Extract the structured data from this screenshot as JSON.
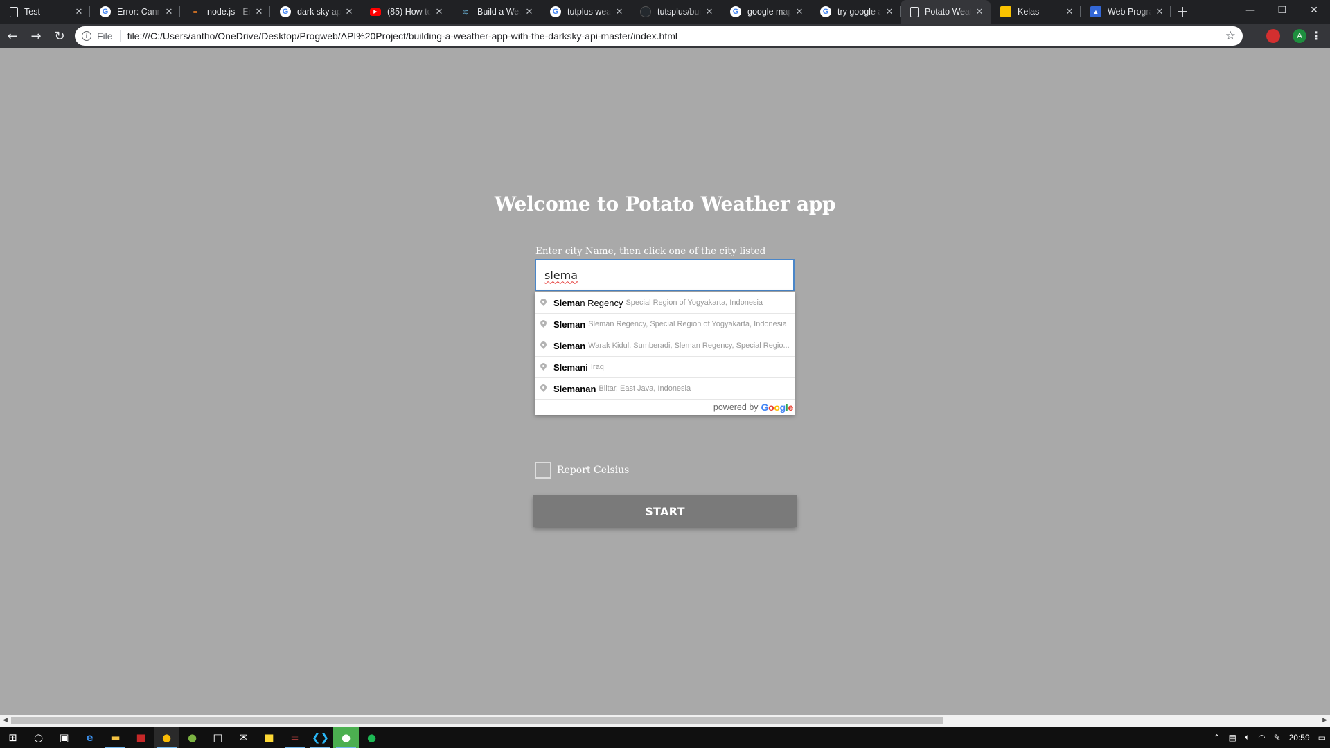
{
  "browser": {
    "tabs": [
      {
        "title": "Test",
        "favicon": "doc"
      },
      {
        "title": "Error: Cannot",
        "favicon": "g"
      },
      {
        "title": "node.js - Err",
        "favicon": "so"
      },
      {
        "title": "dark sky api",
        "favicon": "g"
      },
      {
        "title": "(85) How to",
        "favicon": "yt"
      },
      {
        "title": "Build a Weat",
        "favicon": "ds"
      },
      {
        "title": "tutplus weat",
        "favicon": "g"
      },
      {
        "title": "tutsplus/buil",
        "favicon": "gh"
      },
      {
        "title": "google map",
        "favicon": "g"
      },
      {
        "title": "try google a",
        "favicon": "g"
      },
      {
        "title": "Potato Weat",
        "favicon": "doc",
        "active": true
      },
      {
        "title": "Kelas",
        "favicon": "kelas"
      },
      {
        "title": "Web Progra",
        "favicon": "wp"
      }
    ],
    "new_tab": "+",
    "window_controls": {
      "minimize": "—",
      "restore": "❐",
      "close": "✕"
    },
    "address": {
      "scheme_label": "File",
      "url": "file:///C:/Users/antho/OneDrive/Desktop/Progweb/API%20Project/building-a-weather-app-with-the-darksky-api-master/index.html"
    },
    "profile_initial": "A"
  },
  "page": {
    "heading": "Welcome to Potato Weather app",
    "input_label": "Enter city Name, then click one of the city listed",
    "input_value": "slema",
    "suggestions": [
      {
        "match": "Slema",
        "rest": "n Regency",
        "secondary": "Special Region of Yogyakarta, Indonesia"
      },
      {
        "match": "Sleman",
        "rest": "",
        "secondary": "Sleman Regency, Special Region of Yogyakarta, Indonesia"
      },
      {
        "match": "Sleman",
        "rest": "",
        "secondary": "Warak Kidul, Sumberadi, Sleman Regency, Special Regio..."
      },
      {
        "match": "Slemani",
        "rest": "",
        "secondary": "Iraq"
      },
      {
        "match": "Slemanan",
        "rest": "",
        "secondary": "Blitar, East Java, Indonesia"
      }
    ],
    "powered_by": "powered by",
    "powered_brand": "Google",
    "celsius_label": "Report Celsius",
    "start_label": "START"
  },
  "taskbar": {
    "time": "20:59"
  },
  "colors": {
    "page_bg": "#a9a9a9",
    "input_border": "#4a86c8",
    "button_bg": "#7a7a7a"
  }
}
